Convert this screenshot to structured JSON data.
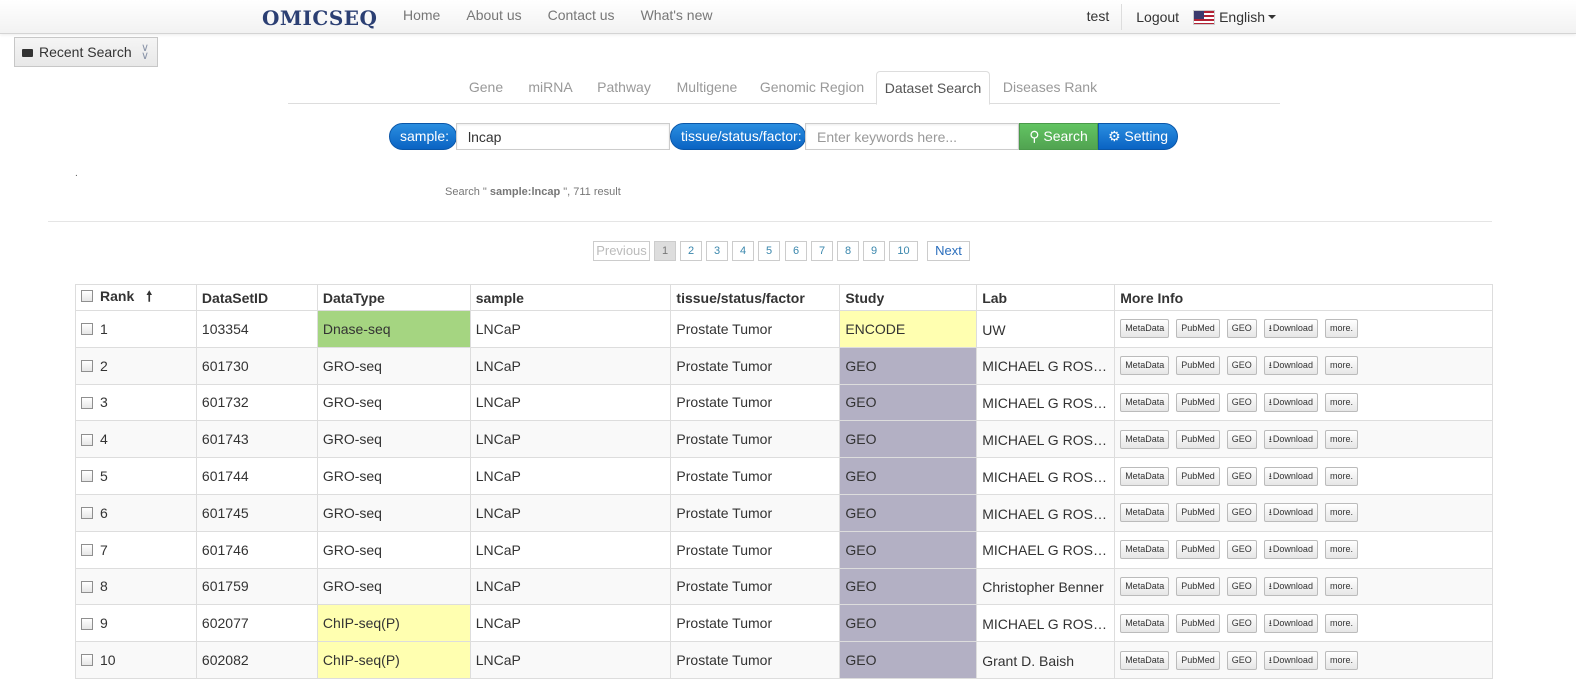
{
  "nav": {
    "logo": "OMICSEQ",
    "links": [
      "Home",
      "About us",
      "Contact us",
      "What's new"
    ],
    "user": "test",
    "logout": "Logout",
    "language": "English"
  },
  "recent_search": {
    "label": "Recent Search"
  },
  "tabs": [
    {
      "label": "Gene",
      "active": false
    },
    {
      "label": "miRNA",
      "active": false
    },
    {
      "label": "Pathway",
      "active": false
    },
    {
      "label": "Multigene",
      "active": false
    },
    {
      "label": "Genomic Region",
      "active": false
    },
    {
      "label": "Dataset Search",
      "active": true
    },
    {
      "label": "Diseases Rank",
      "active": false
    }
  ],
  "search": {
    "sample_label": "sample:",
    "sample_value": "lncap",
    "tissue_label": "tissue/status/factor:",
    "tissue_placeholder": "Enter keywords here...",
    "search_button": "Search",
    "setting_button": "Setting"
  },
  "dot": ".",
  "summary": {
    "prefix": "Search \" ",
    "query": "sample:lncap",
    "suffix": " \", 711 result"
  },
  "pagination": {
    "previous": "Previous",
    "pages": [
      "1",
      "2",
      "3",
      "4",
      "5",
      "6",
      "7",
      "8",
      "9",
      "10"
    ],
    "current": "1",
    "next": "Next"
  },
  "table": {
    "columns": [
      "Rank",
      "DataSetID",
      "DataType",
      "sample",
      "tissue/status/factor",
      "Study",
      "Lab",
      "More Info"
    ],
    "action_buttons": [
      "MetaData",
      "PubMed",
      "GEO",
      "Download",
      "more."
    ],
    "rows": [
      {
        "rank": "1",
        "id": "103354",
        "type": "Dnase-seq",
        "type_color": "green",
        "sample": "LNCaP",
        "tissue": "Prostate Tumor",
        "study": "ENCODE",
        "study_color": "yellow",
        "lab": "UW"
      },
      {
        "rank": "2",
        "id": "601730",
        "type": "GRO-seq",
        "type_color": "",
        "sample": "LNCaP",
        "tissue": "Prostate Tumor",
        "study": "GEO",
        "study_color": "grey",
        "lab": "MICHAEL G ROSENFELD"
      },
      {
        "rank": "3",
        "id": "601732",
        "type": "GRO-seq",
        "type_color": "",
        "sample": "LNCaP",
        "tissue": "Prostate Tumor",
        "study": "GEO",
        "study_color": "grey",
        "lab": "MICHAEL G ROSENFELD"
      },
      {
        "rank": "4",
        "id": "601743",
        "type": "GRO-seq",
        "type_color": "",
        "sample": "LNCaP",
        "tissue": "Prostate Tumor",
        "study": "GEO",
        "study_color": "grey",
        "lab": "MICHAEL G ROSENFELD"
      },
      {
        "rank": "5",
        "id": "601744",
        "type": "GRO-seq",
        "type_color": "",
        "sample": "LNCaP",
        "tissue": "Prostate Tumor",
        "study": "GEO",
        "study_color": "grey",
        "lab": "MICHAEL G ROSENFELD"
      },
      {
        "rank": "6",
        "id": "601745",
        "type": "GRO-seq",
        "type_color": "",
        "sample": "LNCaP",
        "tissue": "Prostate Tumor",
        "study": "GEO",
        "study_color": "grey",
        "lab": "MICHAEL G ROSENFELD"
      },
      {
        "rank": "7",
        "id": "601746",
        "type": "GRO-seq",
        "type_color": "",
        "sample": "LNCaP",
        "tissue": "Prostate Tumor",
        "study": "GEO",
        "study_color": "grey",
        "lab": "MICHAEL G ROSENFELD"
      },
      {
        "rank": "8",
        "id": "601759",
        "type": "GRO-seq",
        "type_color": "",
        "sample": "LNCaP",
        "tissue": "Prostate Tumor",
        "study": "GEO",
        "study_color": "grey",
        "lab": "Christopher Benner"
      },
      {
        "rank": "9",
        "id": "602077",
        "type": "ChIP-seq(P)",
        "type_color": "yellow",
        "sample": "LNCaP",
        "tissue": "Prostate Tumor",
        "study": "GEO",
        "study_color": "grey",
        "lab": "MICHAEL G ROSENFELD"
      },
      {
        "rank": "10",
        "id": "602082",
        "type": "ChIP-seq(P)",
        "type_color": "yellow",
        "sample": "LNCaP",
        "tissue": "Prostate Tumor",
        "study": "GEO",
        "study_color": "grey",
        "lab": "Grant D. Baish"
      }
    ]
  }
}
